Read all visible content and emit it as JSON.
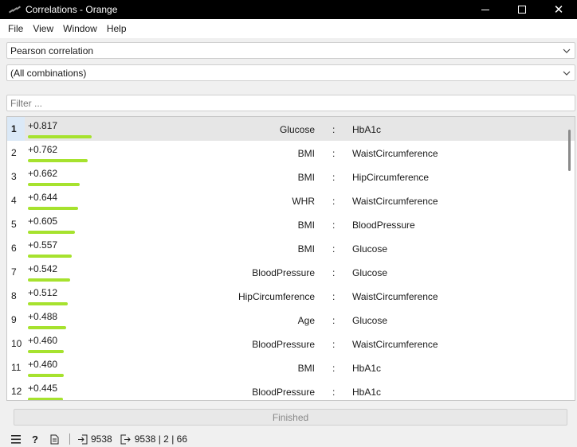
{
  "window": {
    "title": "Correlations - Orange"
  },
  "menu": [
    "File",
    "View",
    "Window",
    "Help"
  ],
  "correlation_type": "Pearson correlation",
  "feature_filter": "(All combinations)",
  "filter": {
    "placeholder": "Filter ...",
    "value": ""
  },
  "rows": [
    {
      "n": "1",
      "value": "+0.817",
      "a": "Glucose",
      "b": "HbA1c"
    },
    {
      "n": "2",
      "value": "+0.762",
      "a": "BMI",
      "b": "WaistCircumference"
    },
    {
      "n": "3",
      "value": "+0.662",
      "a": "BMI",
      "b": "HipCircumference"
    },
    {
      "n": "4",
      "value": "+0.644",
      "a": "WHR",
      "b": "WaistCircumference"
    },
    {
      "n": "5",
      "value": "+0.605",
      "a": "BMI",
      "b": "BloodPressure"
    },
    {
      "n": "6",
      "value": "+0.557",
      "a": "BMI",
      "b": "Glucose"
    },
    {
      "n": "7",
      "value": "+0.542",
      "a": "BloodPressure",
      "b": "Glucose"
    },
    {
      "n": "8",
      "value": "+0.512",
      "a": "HipCircumference",
      "b": "WaistCircumference"
    },
    {
      "n": "9",
      "value": "+0.488",
      "a": "Age",
      "b": "Glucose"
    },
    {
      "n": "10",
      "value": "+0.460",
      "a": "BloodPressure",
      "b": "WaistCircumference"
    },
    {
      "n": "11",
      "value": "+0.460",
      "a": "BMI",
      "b": "HbA1c"
    },
    {
      "n": "12",
      "value": "+0.445",
      "a": "BloodPressure",
      "b": "HbA1c"
    }
  ],
  "colon": ":",
  "bar_color": "#a6e22e",
  "status": "Finished",
  "footer": {
    "input_count": "9538",
    "output_summary": "9538 | 2 | 66"
  }
}
